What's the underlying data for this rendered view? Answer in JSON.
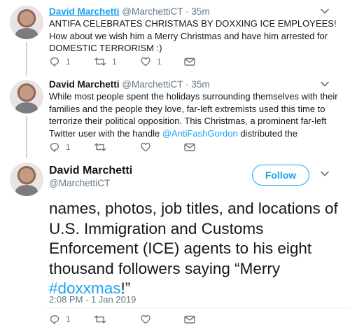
{
  "tweet1": {
    "name": "David Marchetti",
    "handle": "@MarchettiCT",
    "dot": "·",
    "time": "35m",
    "text": "ANTIFA CELEBRATES CHRISTMAS BY DOXXING ICE EMPLOYEES! How about we wish him a Merry Christmas and have him arrested for DOMESTIC TERRORISM :)",
    "reply_count": "1",
    "retweet_count": "1",
    "like_count": "1"
  },
  "tweet2": {
    "name": "David Marchetti",
    "handle": "@MarchettiCT",
    "dot": "·",
    "time": "35m",
    "text_before": "While most people spent the holidays surrounding themselves with their families and the people they love, far-left extremists used this time to terrorize their political opposition. This Christmas, a prominent far-left Twitter user with the handle ",
    "mention": "@AntiFashGordon",
    "text_after": " distributed the",
    "reply_count": "1",
    "retweet_count": "",
    "like_count": ""
  },
  "tweet3": {
    "name": "David Marchetti",
    "handle": "@MarchettiCT",
    "follow_label": "Follow",
    "text_before": "names, photos, job titles, and locations of U.S. Immigration and Customs Enforcement (ICE) agents to his eight thousand followers saying “Merry ",
    "hashtag": "#doxxmas",
    "text_after": "!”",
    "timestamp": "2:08 PM - 1 Jan 2019",
    "reply_count": "1",
    "retweet_count": "",
    "like_count": ""
  },
  "icons": {
    "reply": "reply-icon",
    "retweet": "retweet-icon",
    "like": "heart-icon",
    "dm": "envelope-icon",
    "more": "chevron-down-icon"
  },
  "colors": {
    "accent": "#1da1f2",
    "muted": "#657786",
    "text": "#14171a"
  }
}
